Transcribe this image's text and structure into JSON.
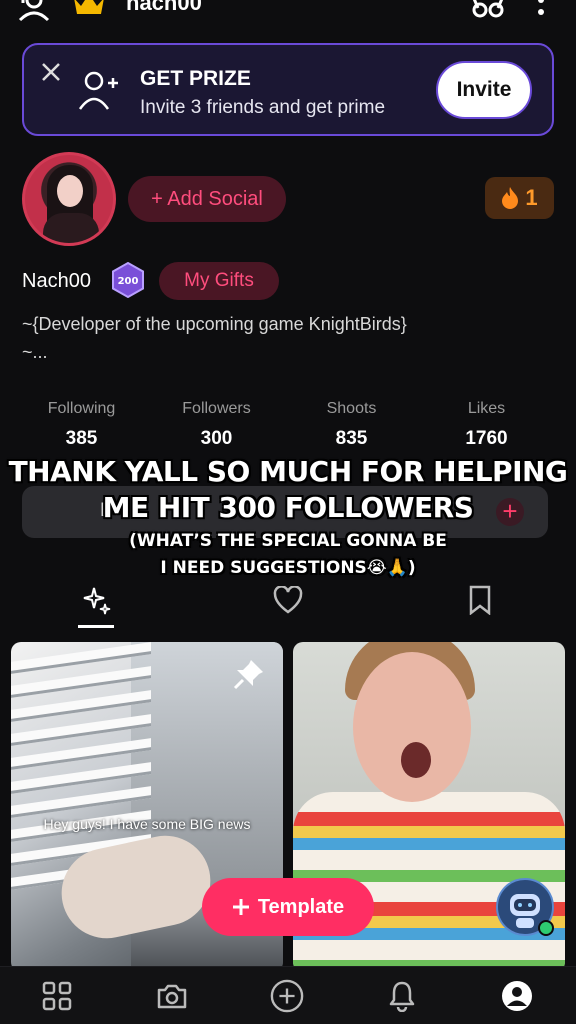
{
  "topbar": {
    "username": "nach00",
    "icons": [
      "add-user-icon",
      "crown-icon",
      "glasses-icon",
      "more-vertical-icon"
    ]
  },
  "prize_banner": {
    "title": "GET PRIZE",
    "subtitle": "Invite 3 friends and get prime",
    "invite_label": "Invite"
  },
  "profile": {
    "add_social_label": "+ Add Social",
    "streak_count": "1",
    "display_name": "Nach00",
    "level": "200",
    "gifts_label": "My Gifts",
    "bio_line1": "~{Developer of the upcoming game KnightBirds}",
    "bio_line2": "~..."
  },
  "stats": [
    {
      "label": "Following",
      "value": "385"
    },
    {
      "label": "Followers",
      "value": "300"
    },
    {
      "label": "Shoots",
      "value": "835"
    },
    {
      "label": "Likes",
      "value": "1760"
    }
  ],
  "edit_row": {
    "label": "E",
    "plus": "+"
  },
  "caption": {
    "line1": "THANK YALL SO MUCH FOR HELPING",
    "line2": "ME HIT 300 FOLLOWERS",
    "line3": "(WHAT’S THE SPECIAL GONNA BE",
    "line4": "I NEED SUGGESTIONS😭🙏)"
  },
  "tabs": [
    "sparkles-icon",
    "heart-icon",
    "bookmark-icon"
  ],
  "videos": [
    {
      "overlay_text": "Hey guys! I have some BIG news",
      "pinned": true
    },
    {
      "overlay_text": "",
      "pinned": false
    }
  ],
  "template_label": "Template",
  "bottom_nav": [
    "grid-icon",
    "camera-icon",
    "plus-circle-icon",
    "bell-icon",
    "profile-icon"
  ],
  "colors": {
    "accent_pink": "#ff2e63",
    "banner_border": "#6a4ad8",
    "streak_orange": "#ff9a2a"
  }
}
